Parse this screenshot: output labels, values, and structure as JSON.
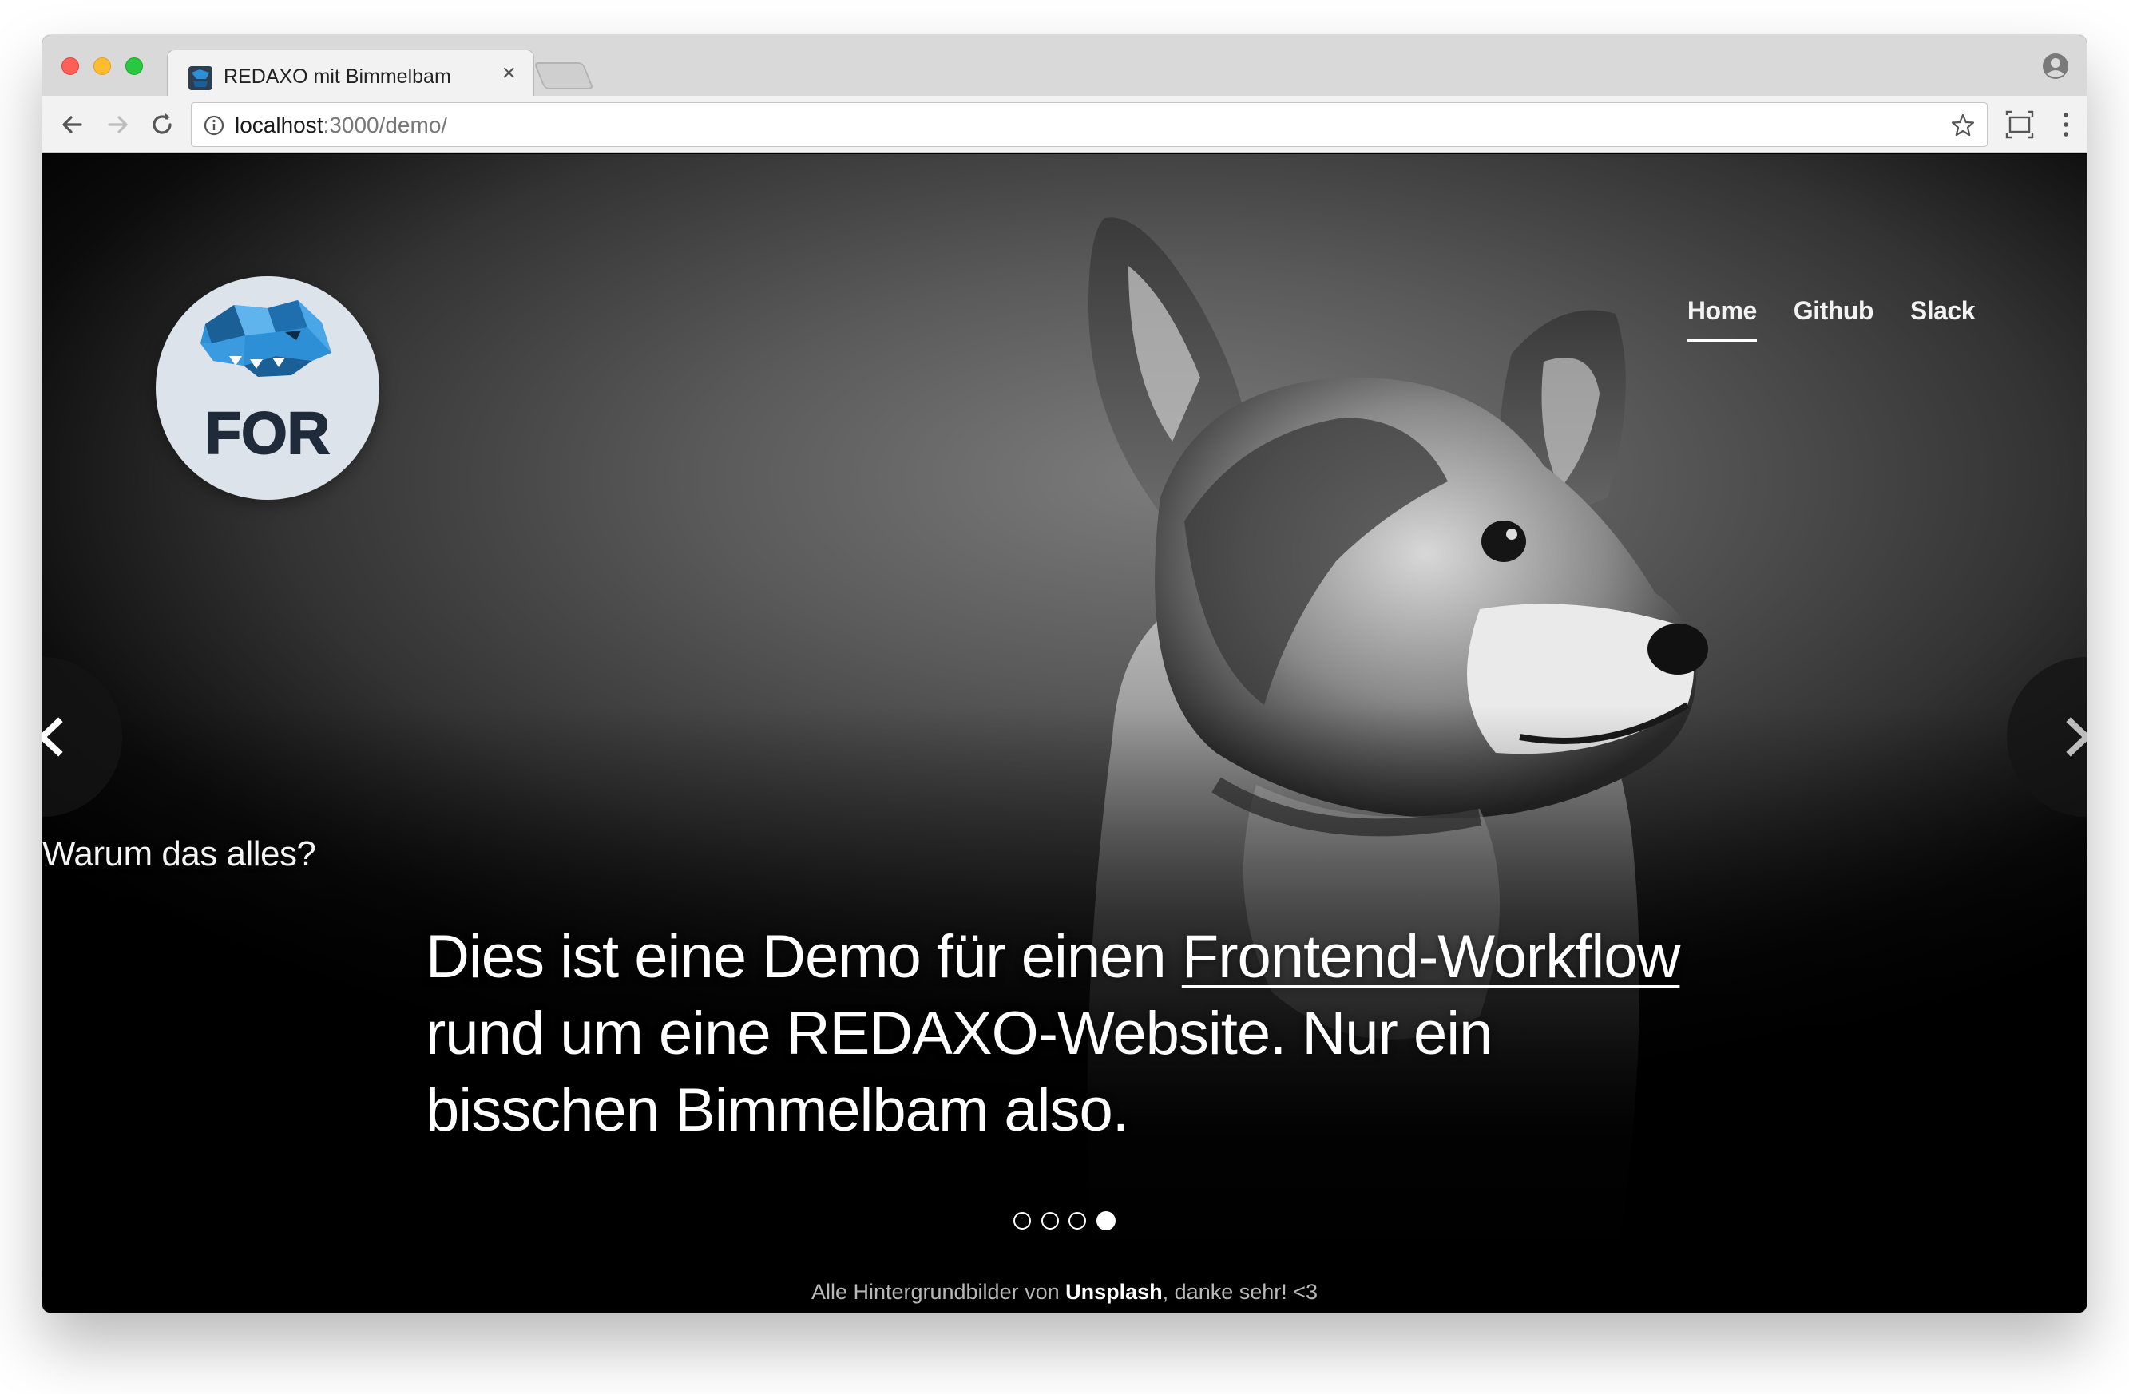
{
  "browser": {
    "tab_title": "REDAXO mit Bimmelbam",
    "tab_close": "×",
    "url_host": "localhost",
    "url_path": ":3000/demo/"
  },
  "nav": {
    "items": [
      {
        "label": "Home",
        "active": true
      },
      {
        "label": "Github",
        "active": false
      },
      {
        "label": "Slack",
        "active": false
      }
    ]
  },
  "logo": {
    "text": "FOR"
  },
  "slider": {
    "caption_title": "Warum das alles?",
    "caption_pre": "Dies ist eine Demo für einen ",
    "caption_link": "Frontend-Workflow",
    "caption_post": " rund um eine REDAXO-Website. Nur ein bisschen Bimmelbam also.",
    "slide_count": 4,
    "active_slide": 4,
    "prev_icon": "chevron-left-icon",
    "next_icon": "chevron-right-icon"
  },
  "footer": {
    "pre": "Alle Hintergrundbilder von ",
    "link": "Unsplash",
    "post": ", danke sehr! <3"
  },
  "colors": {
    "tl_red": "#fe5f57",
    "tl_yellow": "#febc2e",
    "tl_green": "#28c840",
    "logo_blue": "#2d8fd5",
    "logo_dark": "#1f2a3a"
  }
}
